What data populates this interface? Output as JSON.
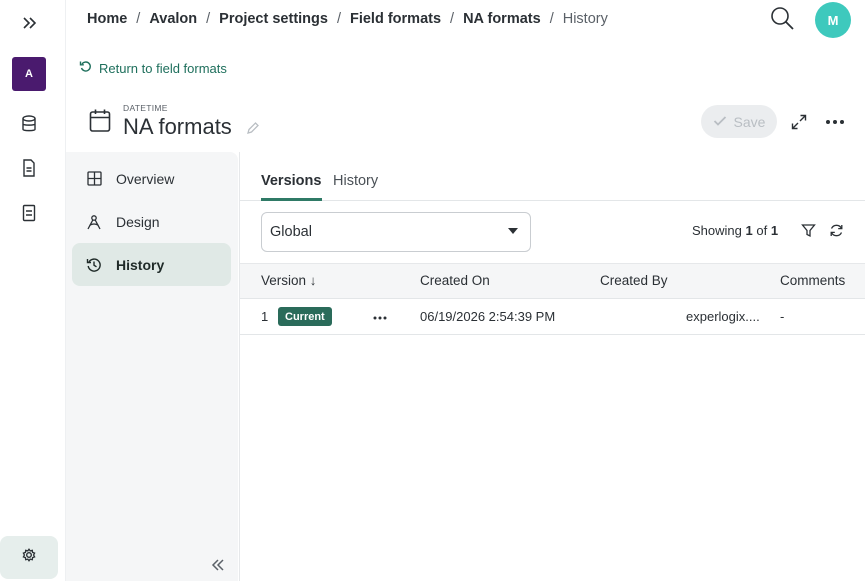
{
  "rail": {
    "workspace_initial": "A"
  },
  "breadcrumb": {
    "items": [
      "Home",
      "Avalon",
      "Project settings",
      "Field formats",
      "NA formats"
    ],
    "current": "History",
    "separator": "/"
  },
  "user": {
    "initial": "M",
    "avatar_color": "#3ec9bd"
  },
  "back_link": {
    "label": "Return to field formats"
  },
  "header": {
    "kicker": "DATETIME",
    "title": "NA formats",
    "save_label": "Save"
  },
  "sidenav": {
    "items": [
      {
        "label": "Overview",
        "icon": "grid-icon"
      },
      {
        "label": "Design",
        "icon": "design-icon"
      },
      {
        "label": "History",
        "icon": "history-icon"
      }
    ],
    "active_index": 2
  },
  "tabs": {
    "items": [
      "Versions",
      "History"
    ],
    "active_index": 0
  },
  "scope": {
    "selected": "Global"
  },
  "pagination": {
    "prefix": "Showing",
    "current": "1",
    "of": "of",
    "total": "1"
  },
  "table": {
    "headers": {
      "version": "Version ↓",
      "created_on": "Created On",
      "created_by": "Created By",
      "comments": "Comments"
    },
    "rows": [
      {
        "version": "1",
        "badge": "Current",
        "created_on": "06/19/2026 2:54:39 PM",
        "created_by": "experlogix....",
        "comments": "-"
      }
    ]
  },
  "colors": {
    "accent": "#2f7a66",
    "badge": "#2a6b5a",
    "workspace": "#4a1a6e"
  }
}
